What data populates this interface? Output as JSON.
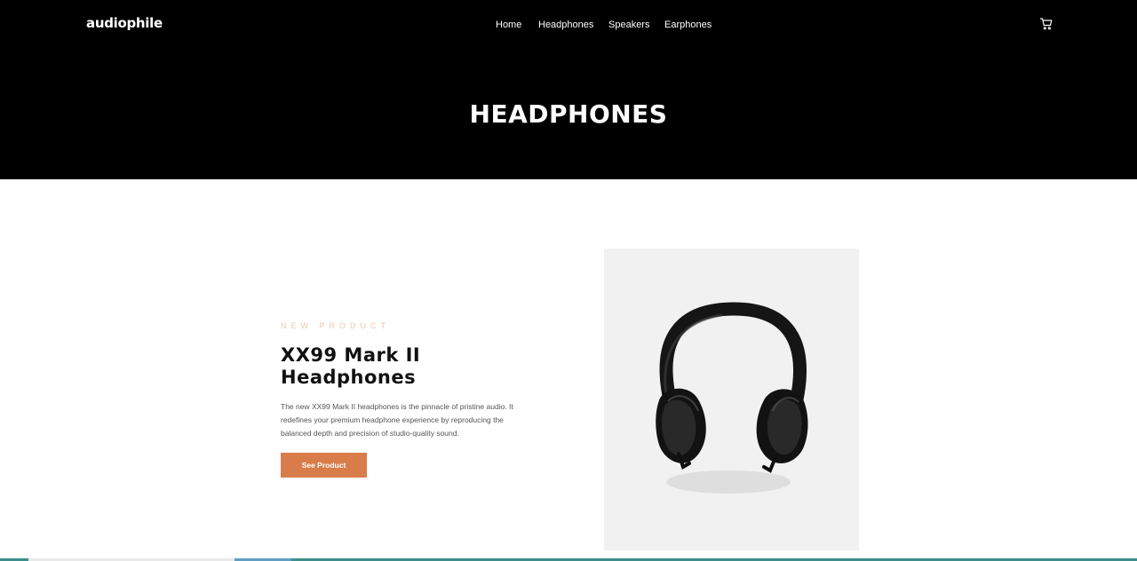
{
  "brand": {
    "logo": "audiophile"
  },
  "nav": {
    "items": [
      {
        "label": "Home"
      },
      {
        "label": "Headphones"
      },
      {
        "label": "Speakers"
      },
      {
        "label": "Earphones"
      }
    ],
    "cart_icon": "cart-icon"
  },
  "hero": {
    "title": "HEADPHONES"
  },
  "product": {
    "overline": "NEW PRODUCT",
    "title": "XX99 Mark II Headphones",
    "description": "The new XX99 Mark II headphones is the pinnacle of pristine audio. It redefines your premium headphone experience by reproducing the balanced depth and precision of studio-quality sound.",
    "cta_label": "See Product",
    "image_icon": "headphones-image"
  },
  "colors": {
    "header_bg": "#000000",
    "accent": "#d87d4a",
    "overline": "#f0c7ad",
    "image_bg": "#f1f1f1"
  }
}
